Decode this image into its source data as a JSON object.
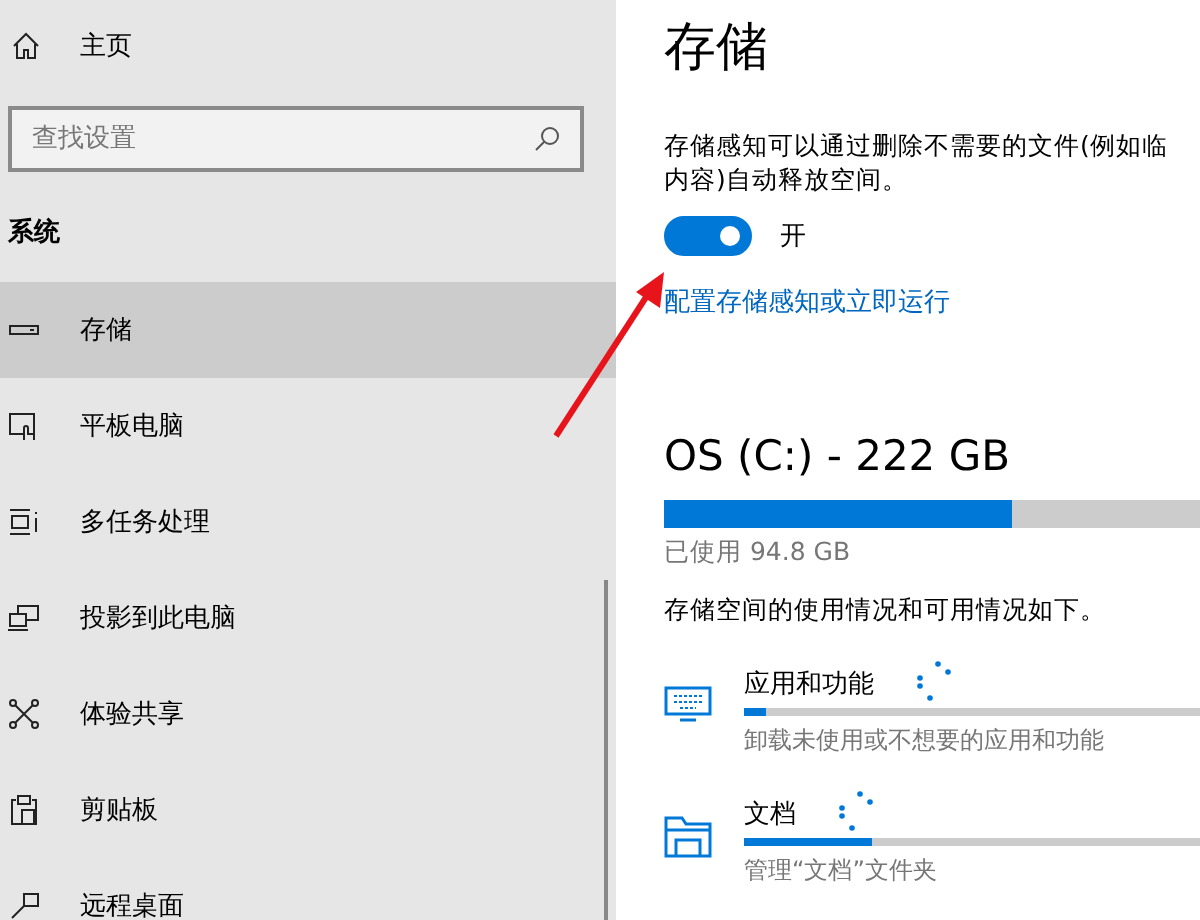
{
  "sidebar": {
    "home": {
      "label": "主页"
    },
    "search": {
      "placeholder": "查找设置"
    },
    "section": "系统",
    "items": [
      {
        "label": "存储",
        "kind": "storage",
        "selected": true
      },
      {
        "label": "平板电脑",
        "kind": "tablet",
        "selected": false
      },
      {
        "label": "多任务处理",
        "kind": "multitask",
        "selected": false
      },
      {
        "label": "投影到此电脑",
        "kind": "project",
        "selected": false
      },
      {
        "label": "体验共享",
        "kind": "share",
        "selected": false
      },
      {
        "label": "剪贴板",
        "kind": "clipboard",
        "selected": false
      },
      {
        "label": "远程桌面",
        "kind": "remote",
        "selected": false
      }
    ]
  },
  "main": {
    "title": "存储",
    "description_lines": [
      "存储感知可以通过删除不需要的文件(例如临",
      "内容)自动释放空间。"
    ],
    "toggle": {
      "on": true,
      "label": "开"
    },
    "link": "配置存储感知或立即运行",
    "drive": {
      "title": "OS (C:) - 222 GB",
      "level": 0.65,
      "used": "已使用 94.8 GB"
    },
    "summary": "存储空间的使用情况和可用情况如下。",
    "categories": [
      {
        "kind": "apps",
        "title": "应用和功能",
        "level": 0.05,
        "description": "卸载未使用或不想要的应用和功能"
      },
      {
        "kind": "documents",
        "title": "文档",
        "level": 0.28,
        "description": "管理“文档”文件夹"
      }
    ]
  }
}
